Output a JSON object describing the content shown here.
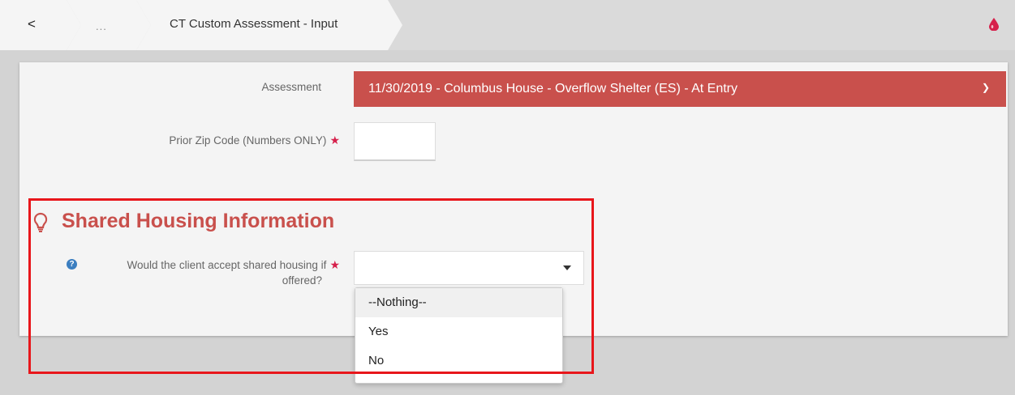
{
  "breadcrumb": {
    "back_label": "<",
    "more_label": "...",
    "title": "CT Custom Assessment - Input"
  },
  "header": {
    "right_icon": "drop-icon",
    "accent_color": "#c9504c"
  },
  "form": {
    "assessment": {
      "label": "Assessment",
      "value": "11/30/2019 - Columbus House - Overflow Shelter (ES) - At Entry"
    },
    "prior_zip": {
      "label": "Prior Zip Code (Numbers ONLY)",
      "required_mark": "★",
      "value": ""
    },
    "section": {
      "title": "Shared Housing Information",
      "icon": "lightbulb-icon"
    },
    "shared_housing": {
      "label_line1": "Would the client accept shared housing if",
      "label_line2": "offered?",
      "required_mark": "★",
      "help_icon": "?",
      "value": "",
      "options": [
        "--Nothing--",
        "Yes",
        "No"
      ]
    }
  }
}
